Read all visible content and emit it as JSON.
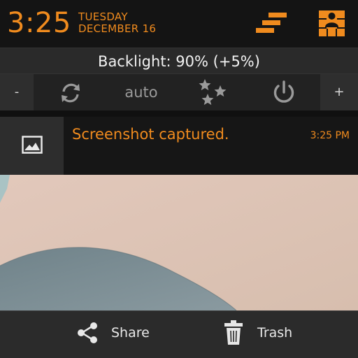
{
  "status": {
    "time": "3:25",
    "day": "TUESDAY",
    "date": "DECEMBER 16"
  },
  "icons": {
    "stairs": "stairs-icon",
    "user_grid": "user-grid-icon",
    "sync": "sync-icon",
    "stars": "stars-icon",
    "power": "power-icon",
    "image": "image-icon",
    "share": "share-icon",
    "trash": "trash-icon"
  },
  "brightness": {
    "label": "Backlight: 90% (+5%)",
    "minus": "-",
    "plus": "+",
    "mode": "auto"
  },
  "notification": {
    "title": "Screenshot captured.",
    "time": "3:25 PM"
  },
  "actions": {
    "share": "Share",
    "trash": "Trash"
  },
  "colors": {
    "accent": "#f08b1e",
    "background": "#141414"
  }
}
